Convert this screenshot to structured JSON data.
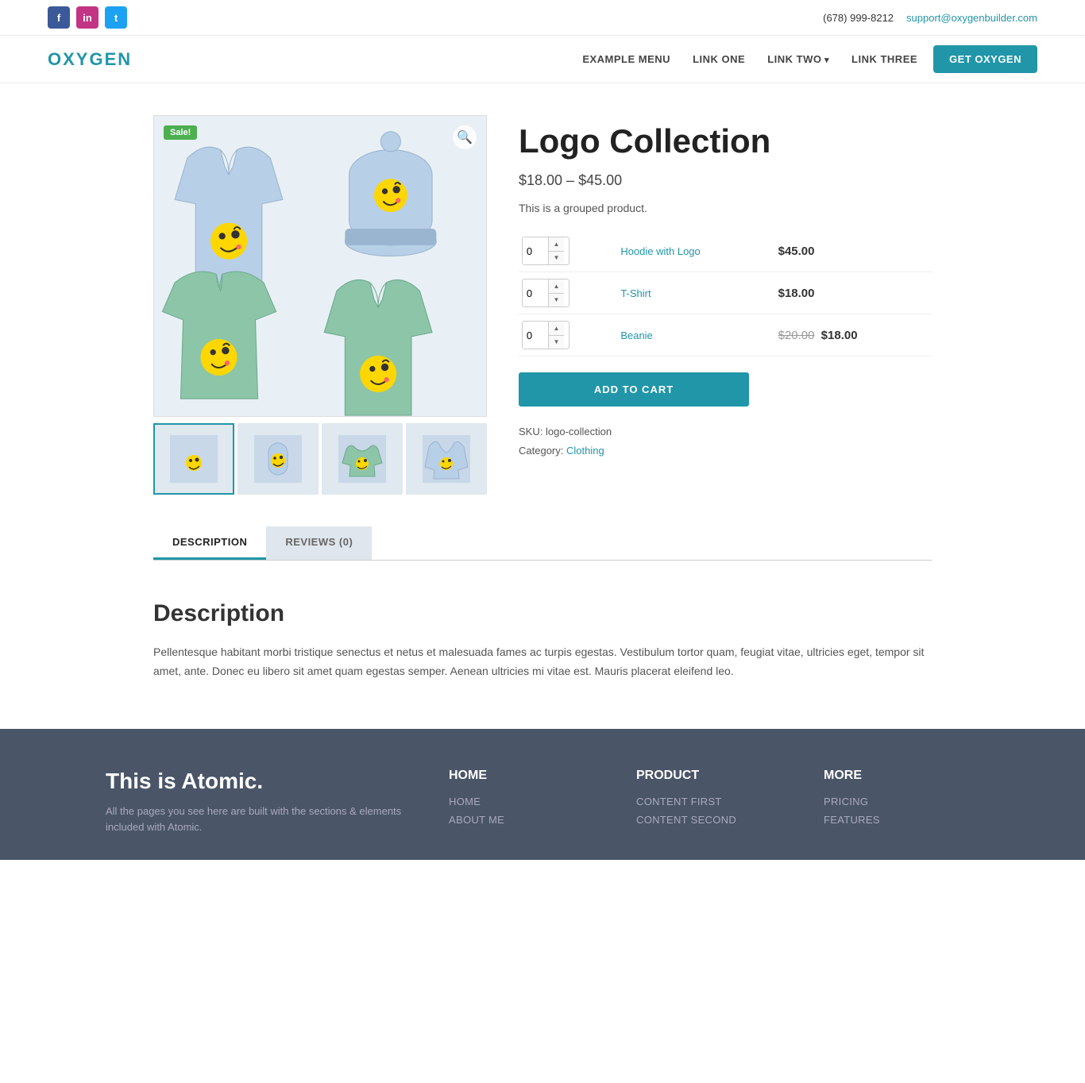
{
  "topbar": {
    "phone": "(678) 999-8212",
    "email": "support@oxygenbuilder.com",
    "socials": [
      {
        "name": "facebook",
        "label": "f"
      },
      {
        "name": "instagram",
        "label": "in"
      },
      {
        "name": "twitter",
        "label": "t"
      }
    ]
  },
  "navbar": {
    "logo": "OXYGEN",
    "links": [
      {
        "label": "EXAMPLE MENU",
        "dropdown": false
      },
      {
        "label": "LINK ONE",
        "dropdown": false
      },
      {
        "label": "LINK TWO",
        "dropdown": true
      },
      {
        "label": "LINK THREE",
        "dropdown": false
      }
    ],
    "cta": "GET OXYGEN"
  },
  "product": {
    "title": "Logo Collection",
    "price_range": "$18.00 – $45.00",
    "description": "This is a grouped product.",
    "sale_badge": "Sale!",
    "items": [
      {
        "name": "Hoodie with Logo",
        "qty": "0",
        "price": "$45.00",
        "price_old": null
      },
      {
        "name": "T-Shirt",
        "qty": "0",
        "price": "$18.00",
        "price_old": null
      },
      {
        "name": "Beanie",
        "qty": "0",
        "price": "$18.00",
        "price_old": "$20.00"
      }
    ],
    "add_to_cart": "ADD TO CART",
    "sku_label": "SKU:",
    "sku": "logo-collection",
    "category_label": "Category:",
    "category": "Clothing"
  },
  "tabs": [
    {
      "label": "DESCRIPTION",
      "active": true
    },
    {
      "label": "REVIEWS (0)",
      "active": false
    }
  ],
  "description": {
    "heading": "Description",
    "text": "Pellentesque habitant morbi tristique senectus et netus et malesuada fames ac turpis egestas. Vestibulum tortor quam, feugiat vitae, ultricies eget, tempor sit amet, ante. Donec eu libero sit amet quam egestas semper. Aenean ultricies mi vitae est. Mauris placerat eleifend leo."
  },
  "footer": {
    "brand_title": "This is Atomic.",
    "brand_text": "All the pages you see here are built with the sections & elements included with Atomic.",
    "columns": [
      {
        "title": "HOME",
        "links": [
          "HOME",
          "ABOUT ME"
        ]
      },
      {
        "title": "PRODUCT",
        "links": [
          "CONTENT FIRST",
          "CONTENT SECOND"
        ]
      },
      {
        "title": "MORE",
        "links": [
          "PRICING",
          "FEATURES"
        ]
      }
    ]
  }
}
